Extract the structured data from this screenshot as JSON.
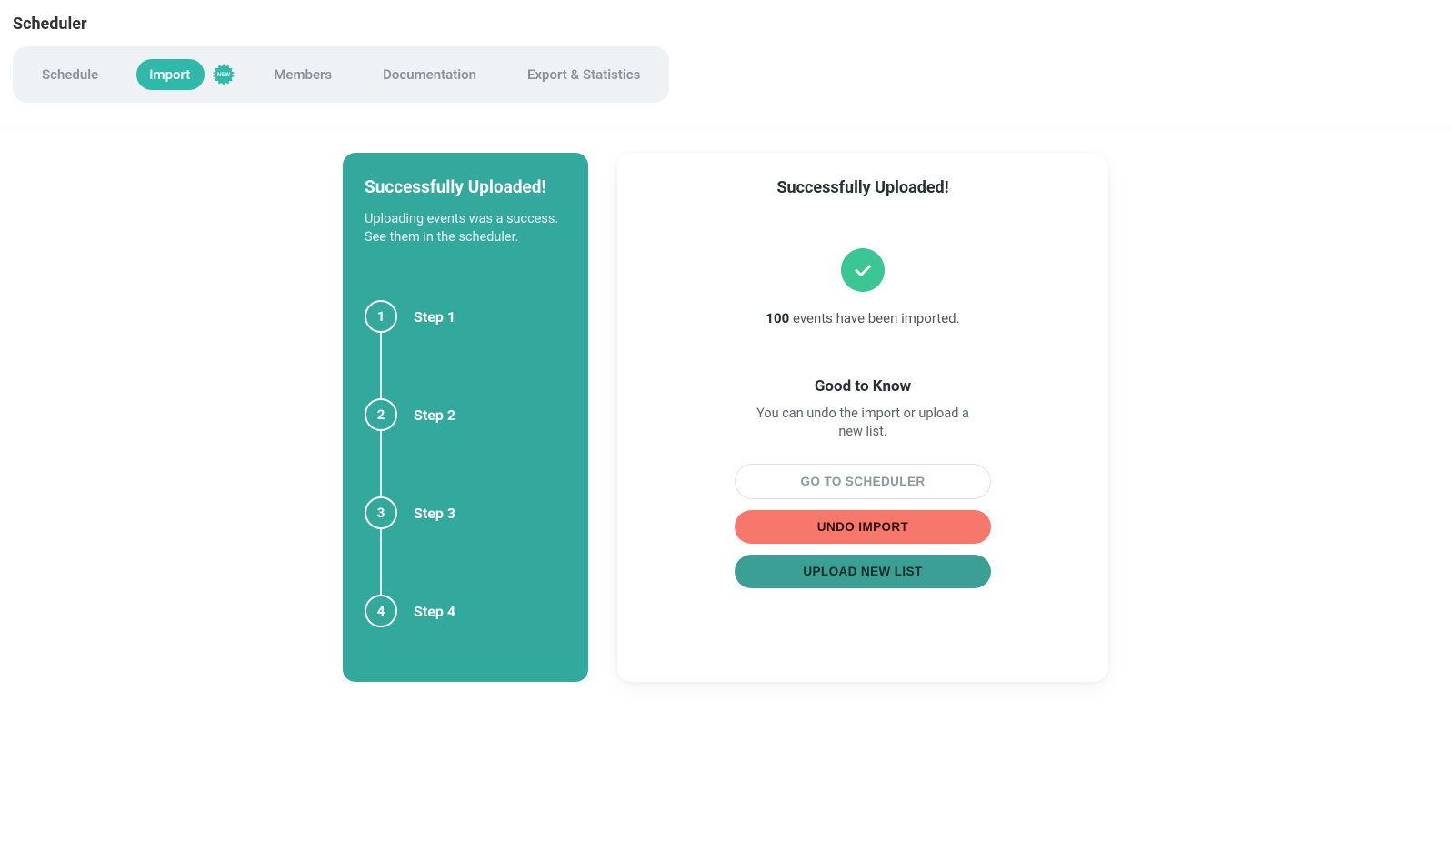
{
  "page": {
    "title": "Scheduler"
  },
  "tabs": {
    "schedule": "Schedule",
    "import": "Import",
    "members": "Members",
    "documentation": "Documentation",
    "export": "Export & Statistics",
    "new_badge": "NEW"
  },
  "left_card": {
    "heading": "Successfully Uploaded!",
    "subtext": "Uploading events was a success. See them in the scheduler.",
    "steps": [
      {
        "num": "1",
        "label": "Step 1"
      },
      {
        "num": "2",
        "label": "Step 2"
      },
      {
        "num": "3",
        "label": "Step 3"
      },
      {
        "num": "4",
        "label": "Step 4"
      }
    ]
  },
  "right_card": {
    "heading": "Successfully Uploaded!",
    "count": "100",
    "count_suffix": " events have been imported.",
    "gtk_heading": "Good to Know",
    "gtk_sub": "You can undo the import or upload a new list.",
    "btn_scheduler": "Go to Scheduler",
    "btn_undo": "Undo Import",
    "btn_upload": "Upload New List"
  }
}
